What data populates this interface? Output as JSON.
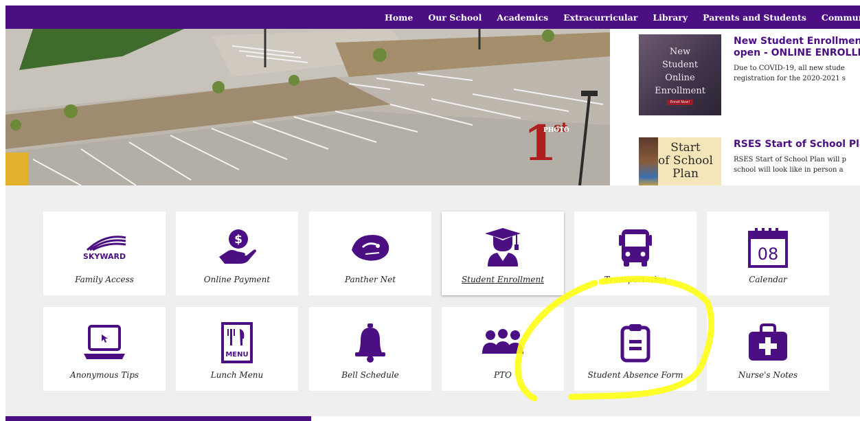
{
  "nav": {
    "items": [
      "Home",
      "Our School",
      "Academics",
      "Extracurricular",
      "Library",
      "Parents and Students",
      "Community"
    ]
  },
  "hero": {
    "badge_number": "1",
    "badge_suffix": "st",
    "badge_word": "PHOTO"
  },
  "news": [
    {
      "title_line1": "New Student Enrollment",
      "title_line2": "open - ONLINE ENROLLM",
      "desc_line1": "Due to COVID-19, all new stude",
      "desc_line2": "registration for the 2020-2021 s",
      "thumb_lines": [
        "New",
        "Student",
        "Online",
        "Enrollment"
      ],
      "thumb_button": "Enroll Now!"
    },
    {
      "title_line1": "RSES Start of School Plan",
      "desc_line1": "RSES Start of School Plan will p",
      "desc_line2": "school will look like in person a",
      "thumb_lines": [
        "Start",
        "of School",
        "Plan"
      ]
    }
  ],
  "tiles": [
    {
      "label": "Family Access",
      "icon": "skyward-logo-icon",
      "logo_text": "SKYWARD"
    },
    {
      "label": "Online Payment",
      "icon": "payment-hand-icon",
      "symbol": "$"
    },
    {
      "label": "Panther Net",
      "icon": "panther-icon"
    },
    {
      "label": "Student Enrollment",
      "icon": "graduate-icon"
    },
    {
      "label": "Transportation",
      "icon": "bus-icon"
    },
    {
      "label": "Calendar",
      "icon": "calendar-icon",
      "day": "08"
    },
    {
      "label": "Anonymous Tips",
      "icon": "laptop-icon"
    },
    {
      "label": "Lunch Menu",
      "icon": "menu-icon",
      "menu_word": "MENU"
    },
    {
      "label": "Bell Schedule",
      "icon": "bell-icon"
    },
    {
      "label": "PTO",
      "icon": "group-icon"
    },
    {
      "label": "Student Absence Form",
      "icon": "clipboard-icon"
    },
    {
      "label": "Nurse's Notes",
      "icon": "medical-kit-icon"
    }
  ],
  "colors": {
    "brand_purple": "#4b0f83",
    "accent_gold": "#e1b12b",
    "highlight_yellow": "#ffff1a"
  }
}
